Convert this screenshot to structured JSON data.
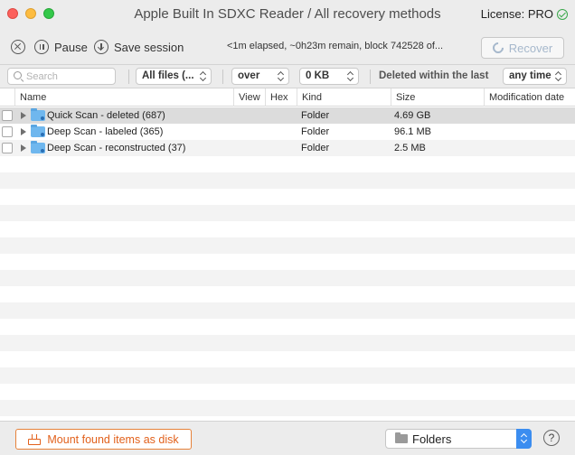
{
  "window": {
    "title": "Apple Built In SDXC Reader / All recovery methods",
    "license_label": "License: PRO"
  },
  "toolbar": {
    "pause_label": "Pause",
    "save_label": "Save session",
    "status_text": "<1m elapsed, ~0h23m remain, block 742528 of...",
    "recover_label": "Recover"
  },
  "filters": {
    "search_placeholder": "Search",
    "file_type": "All files (...",
    "size_operator": "over",
    "size_value": "0 KB",
    "deleted_label": "Deleted within the last",
    "time_range": "any time"
  },
  "table": {
    "columns": [
      "Name",
      "View",
      "Hex",
      "Kind",
      "Size",
      "Modification date"
    ],
    "rows": [
      {
        "name": "Quick Scan - deleted (687)",
        "kind": "Folder",
        "size": "4.69 GB",
        "modified": ""
      },
      {
        "name": "Deep Scan - labeled (365)",
        "kind": "Folder",
        "size": "96.1 MB",
        "modified": ""
      },
      {
        "name": "Deep Scan - reconstructed (37)",
        "kind": "Folder",
        "size": "2.5 MB",
        "modified": ""
      }
    ]
  },
  "bottom": {
    "mount_label": "Mount found items as disk",
    "view_mode": "Folders",
    "help_label": "?"
  },
  "icons": {
    "close": "close-window-icon",
    "minimize": "minimize-window-icon",
    "zoom": "zoom-window-icon",
    "license_status": "check-circle-icon",
    "stop": "stop-icon",
    "pause": "pause-icon",
    "save": "download-icon",
    "recover": "refresh-icon",
    "search": "search-icon",
    "folder": "folder-icon",
    "disk": "disk-icon"
  },
  "colors": {
    "accent": "#3b8df0",
    "mount_orange": "#e2611c",
    "folder_blue": "#6fb7ee",
    "license_green": "#39a74a"
  }
}
